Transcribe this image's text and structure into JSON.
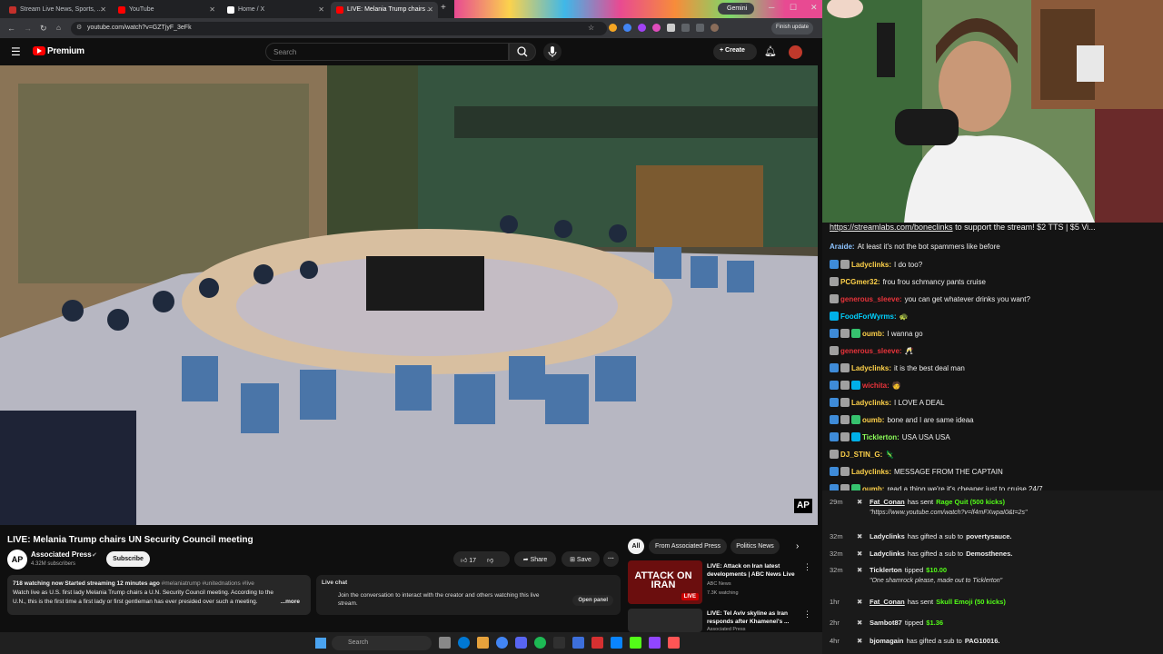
{
  "browser": {
    "tabs": [
      {
        "label": "Stream Live News, Sports, ...",
        "fav": "#c4302b",
        "active": false
      },
      {
        "label": "YouTube",
        "fav": "#ff0000",
        "active": false
      },
      {
        "label": "Home / X",
        "fav": "#ffffff",
        "active": false
      },
      {
        "label": "LIVE: Melania Trump chairs ...",
        "fav": "#ff0000",
        "active": true
      }
    ],
    "gemini_label": "Gemini",
    "url": "youtube.com/watch?v=GZTjyF_3eFk",
    "finish_update_label": "Finish update"
  },
  "youtube": {
    "logo_text": "Premium",
    "search_placeholder": "Search",
    "create_label": "Create",
    "video": {
      "title": "LIVE: Melania Trump chairs UN Security Council meeting",
      "channel": "Associated Press",
      "channel_avatar": "AP",
      "subscribers": "4.32M subscribers",
      "subscribe_label": "Subscribe",
      "likes": "17",
      "share_label": "Share",
      "save_label": "Save",
      "watermark": "AP"
    },
    "description": {
      "stats": "718 watching now  Started streaming 12 minutes ago",
      "hashtags": "#melaniatrump #unitednations #live",
      "text": "Watch live as U.S. first lady Melania Trump chairs a U.N. Security Council meeting. According to the U.N., this is the first time a first lady or first gentleman has ever presided over such a meeting.",
      "more": "...more"
    },
    "live_chat": {
      "title": "Live chat",
      "text": "Join the conversation to interact with the creator and others watching this live stream.",
      "open_panel": "Open panel"
    },
    "filters": [
      "All",
      "From Associated Press",
      "Politics News"
    ],
    "recommendations": [
      {
        "title": "LIVE: Attack on Iran latest developments | ABC News Live",
        "channel": "ABC News",
        "meta": "7.3K watching",
        "thumb_text": "ATTACK ON IRAN",
        "badge": "LIVE"
      },
      {
        "title": "LIVE: Tel Aviv skyline as Iran responds after Khamenei's ...",
        "channel": "Associated Press",
        "meta": "",
        "thumb_text": "",
        "badge": ""
      }
    ]
  },
  "chat": {
    "header_link": "https://streamlabs.com/boneclinks",
    "header_text": "to support the stream! $2 TTS | $5 Vi...",
    "messages": [
      {
        "user": "Araide:",
        "text": "At least it's not the bot spammers like before",
        "color": "#8dc4ff",
        "icons": []
      },
      {
        "user": "Ladyclinks:",
        "text": "I do too?",
        "color": "#ffd24a",
        "icons": [
          "#3e8bd8",
          "#a0a0a0"
        ]
      },
      {
        "user": "PCGmer32:",
        "text": "frou frou schmancy pants cruise",
        "color": "#ffd24a",
        "icons": [
          "#a0a0a0"
        ]
      },
      {
        "user": "generous_sleeve:",
        "text": "you can get whatever drinks you want?",
        "color": "#e8333a",
        "icons": [
          "#a0a0a0"
        ]
      },
      {
        "user": "FoodForWyrms:",
        "text": "🐢",
        "color": "#00d2ff",
        "icons": [
          "#00b0e8"
        ]
      },
      {
        "user": "oumb:",
        "text": "I wanna go",
        "color": "#ffd24a",
        "icons": [
          "#3e8bd8",
          "#a0a0a0",
          "#36c26e"
        ]
      },
      {
        "user": "generous_sleeve:",
        "text": "🥂",
        "color": "#e8333a",
        "icons": [
          "#a0a0a0"
        ]
      },
      {
        "user": "Ladyclinks:",
        "text": "it is the best deal man",
        "color": "#ffd24a",
        "icons": [
          "#3e8bd8",
          "#a0a0a0"
        ]
      },
      {
        "user": "wichita:",
        "text": "🧑",
        "color": "#e8333a",
        "icons": [
          "#3e8bd8",
          "#a0a0a0",
          "#00b0e8"
        ]
      },
      {
        "user": "Ladyclinks:",
        "text": "I LOVE A DEAL",
        "color": "#ffd24a",
        "icons": [
          "#3e8bd8",
          "#a0a0a0"
        ]
      },
      {
        "user": "oumb:",
        "text": "bone and I are same ideaa",
        "color": "#ffd24a",
        "icons": [
          "#3e8bd8",
          "#a0a0a0",
          "#36c26e"
        ]
      },
      {
        "user": "Ticklerton:",
        "text": "USA USA USA",
        "color": "#8dff5a",
        "icons": [
          "#3e8bd8",
          "#a0a0a0",
          "#00b0e8"
        ]
      },
      {
        "user": "DJ_STIN_G:",
        "text": "🦎",
        "color": "#ffd24a",
        "icons": [
          "#a0a0a0"
        ]
      },
      {
        "user": "Ladyclinks:",
        "text": "MESSAGE FROM THE CAPTAIN",
        "color": "#ffd24a",
        "icons": [
          "#3e8bd8",
          "#a0a0a0"
        ]
      },
      {
        "user": "oumb:",
        "text": "read a thing we're it's cheaper just to cruise 24/7",
        "color": "#ffd24a",
        "icons": [
          "#3e8bd8",
          "#a0a0a0",
          "#36c26e"
        ]
      }
    ]
  },
  "events": [
    {
      "time": "29m",
      "user": "Fat_Conan",
      "action": "has sent",
      "item": "Rage Quit (500 kicks)",
      "sub": "\"https://www.youtube.com/watch?v=lf4mFXwpaI0&t=2s\""
    },
    {
      "time": "32m",
      "user": "Ladyclinks",
      "action": "has gifted a sub to",
      "item": "povertysauce.",
      "sub": ""
    },
    {
      "time": "32m",
      "user": "Ladyclinks",
      "action": "has gifted a sub to",
      "item": "Demosthenes.",
      "sub": ""
    },
    {
      "time": "32m",
      "user": "Ticklerton",
      "action": "tipped",
      "item": "$10.00",
      "sub": "\"One shamrock please, made out to Ticklerton\""
    },
    {
      "time": "1hr",
      "user": "Fat_Conan",
      "action": "has sent",
      "item": "Skull Emoji (50 kicks)",
      "sub": ""
    },
    {
      "time": "2hr",
      "user": "Sambot87",
      "action": "tipped",
      "item": "$1.36",
      "sub": ""
    },
    {
      "time": "4hr",
      "user": "bjomagain",
      "action": "has gifted a sub to",
      "item": "PAG10016.",
      "sub": ""
    }
  ],
  "taskbar": {
    "search_placeholder": "Search"
  },
  "colors": {
    "accent_red": "#ff0000",
    "chat_bg": "#141414",
    "kick_green": "#53fc18"
  }
}
